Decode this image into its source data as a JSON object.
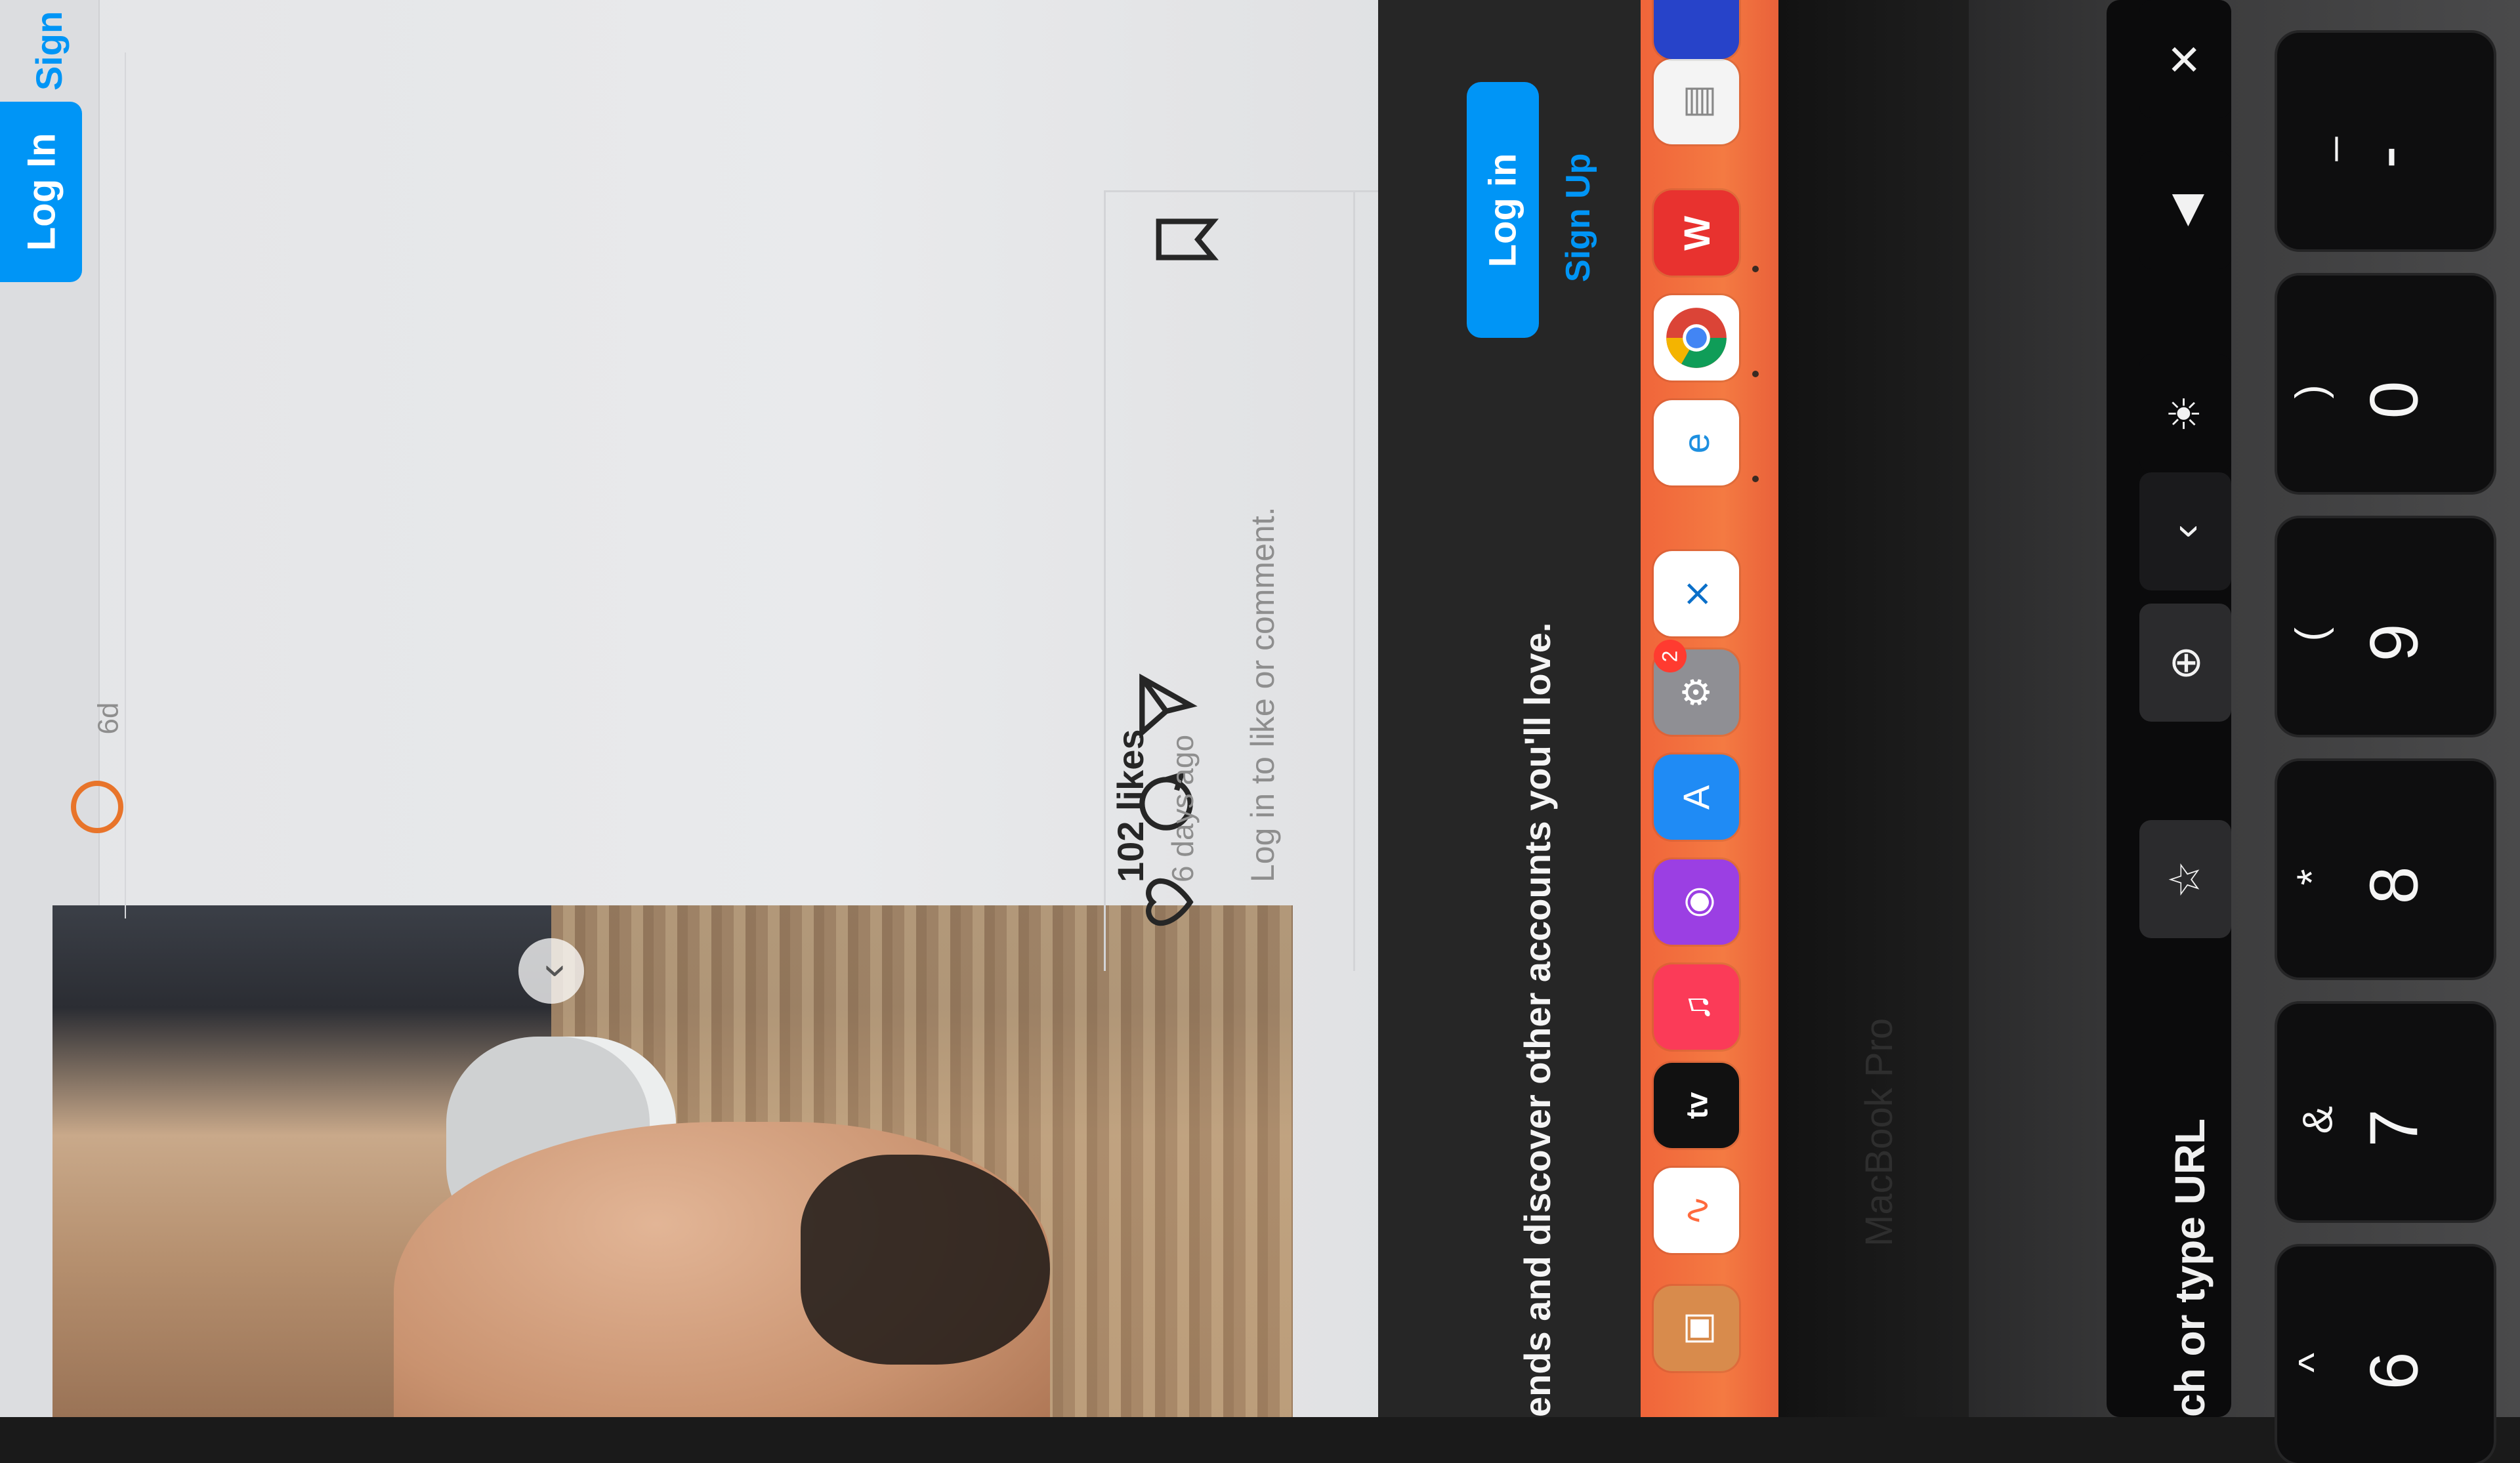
{
  "header": {
    "login_label": "Log In",
    "signup_label": "Sign"
  },
  "post": {
    "timestamp_short": "6d",
    "likes": "102 likes",
    "time_ago": "6 days ago",
    "login_prompt": "Log in to like or comment."
  },
  "banner": {
    "text": "ends and discover other accounts you'll love.",
    "login_label": "Log in",
    "signup_label": "Sign Up"
  },
  "dock": {
    "apps": [
      {
        "name": "preview-icon",
        "glyph": "▣"
      },
      {
        "name": "freeform-icon",
        "glyph": "∿"
      },
      {
        "name": "apple-tv-icon",
        "glyph": "tv"
      },
      {
        "name": "music-icon",
        "glyph": "♫"
      },
      {
        "name": "podcasts-icon",
        "glyph": "◉"
      },
      {
        "name": "app-store-icon",
        "glyph": "A"
      },
      {
        "name": "settings-icon",
        "glyph": "⚙"
      },
      {
        "name": "vscode-icon",
        "glyph": "⨯"
      },
      {
        "name": "edge-icon",
        "glyph": "e"
      },
      {
        "name": "chrome-icon",
        "glyph": "◎"
      },
      {
        "name": "wps-icon",
        "glyph": "W"
      },
      {
        "name": "document-icon",
        "glyph": "▤"
      }
    ],
    "settings_badge": "2"
  },
  "laptop": {
    "brand": "MacBook Pro",
    "touchbar_url": "ch or type URL",
    "keys": [
      {
        "upper": "^",
        "lower": "6"
      },
      {
        "upper": "&",
        "lower": "7"
      },
      {
        "upper": "*",
        "lower": "8"
      },
      {
        "upper": "(",
        "lower": "9"
      },
      {
        "upper": ")",
        "lower": "0"
      },
      {
        "upper": "_",
        "lower": "-"
      }
    ]
  },
  "colors": {
    "instagram_blue": "#0095f6",
    "banner_dark": "#262626",
    "dock_orange": "#f0653a"
  }
}
